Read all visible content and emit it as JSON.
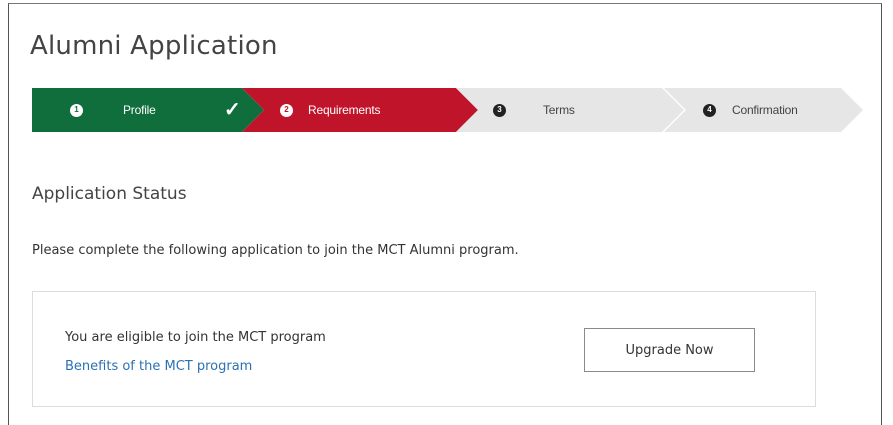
{
  "page": {
    "title": "Alumni Application"
  },
  "wizard": {
    "steps": [
      {
        "number": "1",
        "label": "Profile",
        "state": "completed",
        "color": "#0f6e3c"
      },
      {
        "number": "2",
        "label": "Requirements",
        "state": "current",
        "color": "#c0142b"
      },
      {
        "number": "3",
        "label": "Terms",
        "state": "pending",
        "color": "#e6e6e6"
      },
      {
        "number": "4",
        "label": "Confirmation",
        "state": "pending",
        "color": "#e6e6e6"
      }
    ],
    "completed_icon": "check-icon"
  },
  "status": {
    "title": "Application Status",
    "intro": "Please complete the following application to join the MCT Alumni program."
  },
  "card": {
    "eligible_text": "You are eligible to join the MCT program",
    "benefits_link": "Benefits of the MCT program",
    "upgrade_label": "Upgrade Now"
  },
  "colors": {
    "link": "#2a72b5",
    "completed": "#0f6e3c",
    "current": "#c0142b",
    "pending": "#e6e6e6"
  }
}
